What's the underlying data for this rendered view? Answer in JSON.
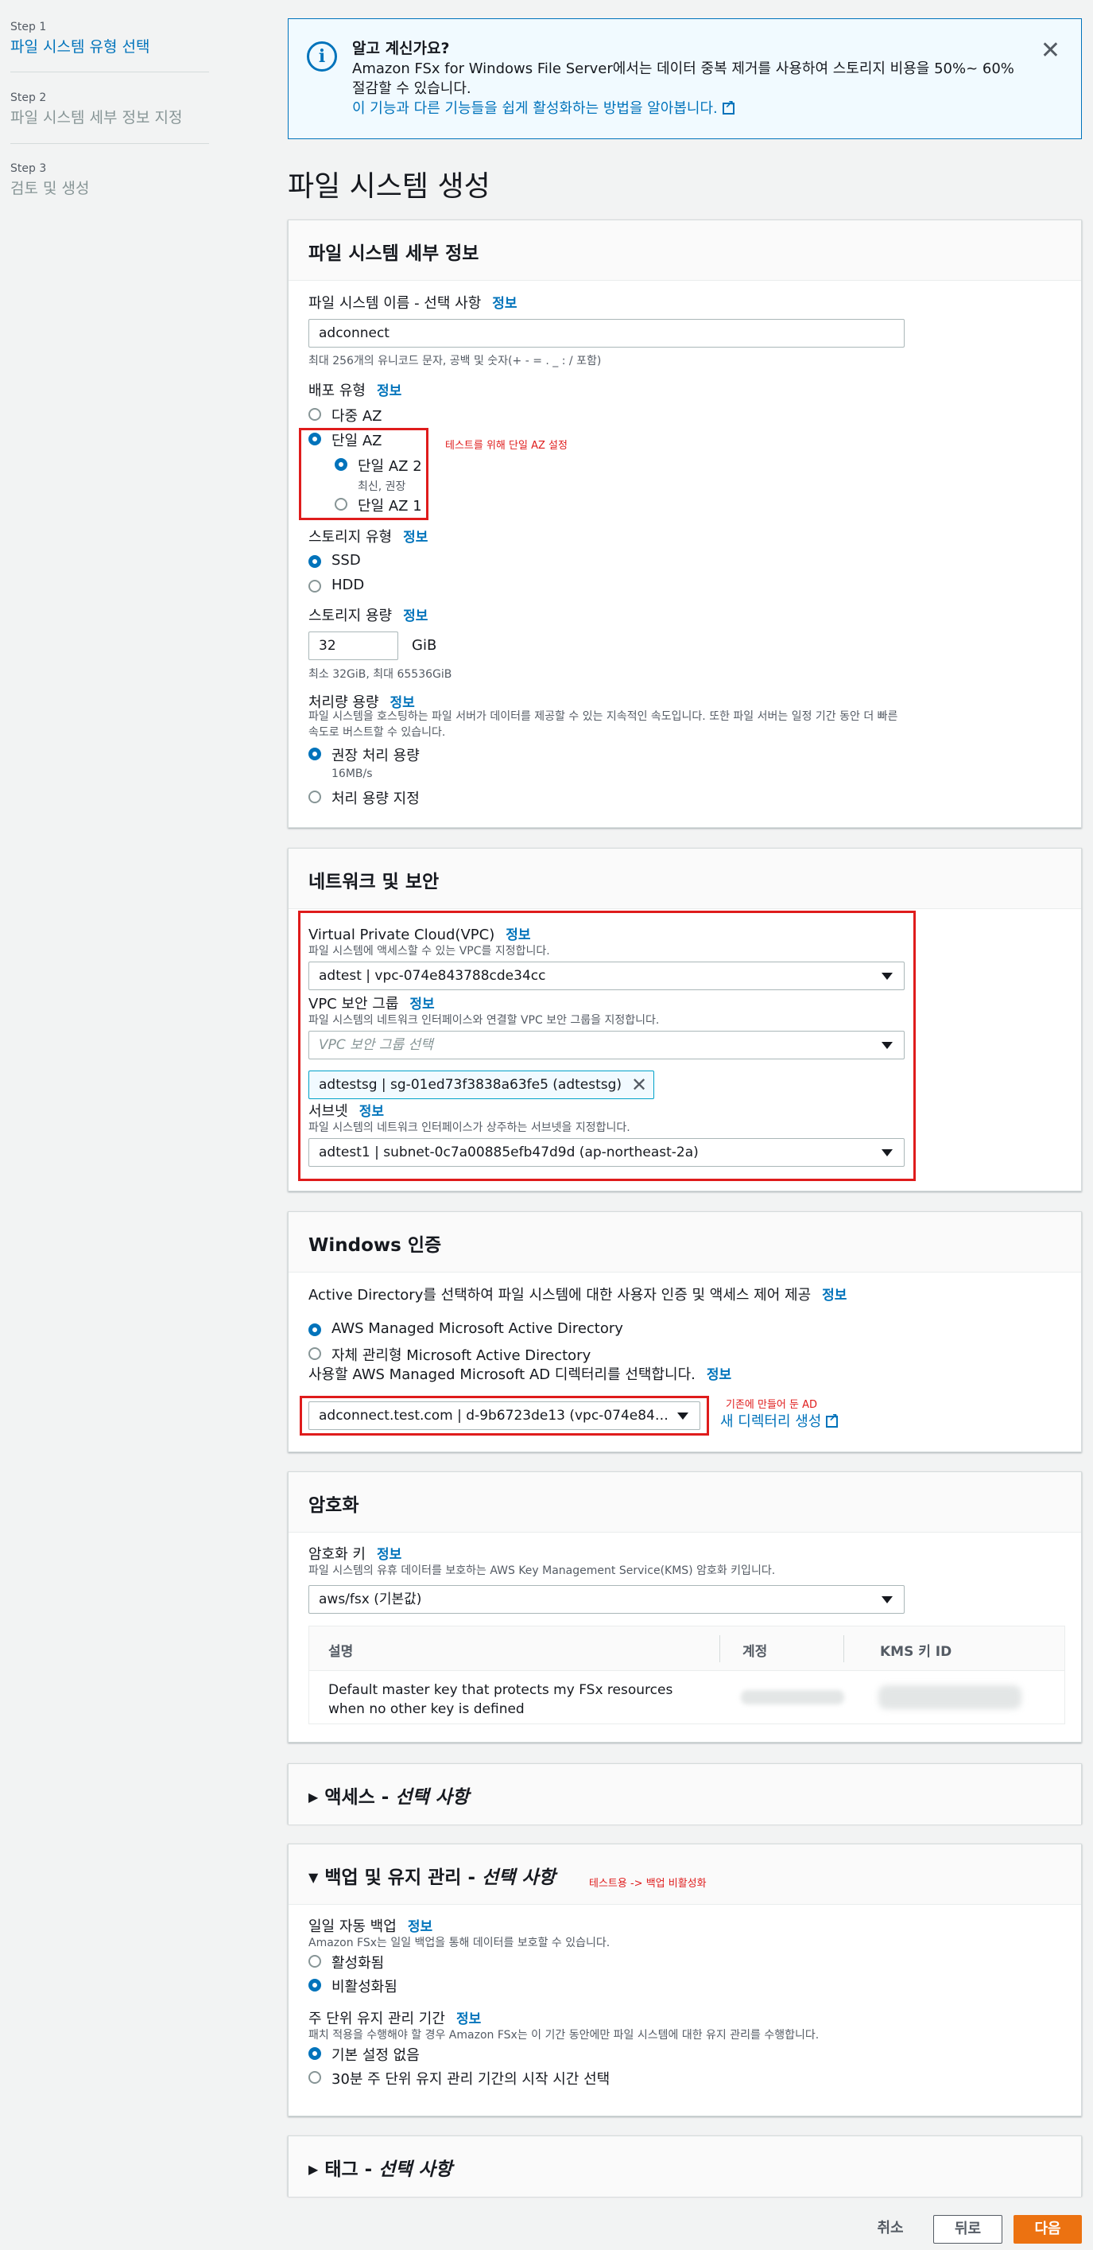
{
  "steps": [
    {
      "small": "Step 1",
      "label": "파일 시스템 유형 선택"
    },
    {
      "small": "Step 2",
      "label": "파일 시스템 세부 정보 지정"
    },
    {
      "small": "Step 3",
      "label": "검토 및 생성"
    }
  ],
  "alert": {
    "title": "알고 계신가요?",
    "body": "Amazon FSx for Windows File Server에서는 데이터 중복 제거를 사용하여 스토리지 비용을 50%~ 60% 절감할 수 있습니다.",
    "link": "이 기능과 다른 기능들을 쉽게 활성화하는 방법을 알아봅니다."
  },
  "page_title": "파일 시스템 생성",
  "info": "정보",
  "details": {
    "header": "파일 시스템 세부 정보",
    "name_label": "파일 시스템 이름 - 선택 사항",
    "name_value": "adconnect",
    "name_desc": "최대 256개의 유니코드 문자, 공백 및 숫자(+ - = . _ : / 포함)",
    "deploy_label": "배포 유형",
    "multi_az": "다중 AZ",
    "single_az": "단일 AZ",
    "single_az2": "단일 AZ 2",
    "single_az2_sub": "최신, 권장",
    "single_az1": "단일 AZ 1",
    "annotation": "테스트를 위해 단일 AZ 설정",
    "storage_type_label": "스토리지 유형",
    "ssd": "SSD",
    "hdd": "HDD",
    "capacity_label": "스토리지 용량",
    "capacity_value": "32",
    "capacity_unit": "GiB",
    "capacity_desc": "최소 32GiB, 최대 65536GiB",
    "throughput_label": "처리량 용량",
    "throughput_desc": "파일 시스템을 호스팅하는 파일 서버가 데이터를 제공할 수 있는 지속적인 속도입니다. 또한 파일 서버는 일정 기간 동안 더 빠른 속도로 버스트할 수 있습니다.",
    "recommended": "권장 처리 용량",
    "recommended_sub": "16MB/s",
    "specify": "처리 용량 지정"
  },
  "network": {
    "header": "네트워크 및 보안",
    "vpc_label": "Virtual Private Cloud(VPC)",
    "vpc_desc": "파일 시스템에 액세스할 수 있는 VPC를 지정합니다.",
    "vpc_value": "adtest | vpc-074e843788cde34cc",
    "sg_label": "VPC 보안 그룹",
    "sg_desc": "파일 시스템의 네트워크 인터페이스와 연결할 VPC 보안 그룹을 지정합니다.",
    "sg_placeholder": "VPC 보안 그룹 선택",
    "sg_token": "adtestsg | sg-01ed73f3838a63fe5 (adtestsg)",
    "subnet_label": "서브넷",
    "subnet_desc": "파일 시스템의 네트워크 인터페이스가 상주하는 서브넷을 지정합니다.",
    "subnet_value": "adtest1 | subnet-0c7a00885efb47d9d (ap-northeast-2a)"
  },
  "windows": {
    "header": "Windows 인증",
    "intro": "Active Directory를 선택하여 파일 시스템에 대한 사용자 인증 및 액세스 제어 제공",
    "managed": "AWS Managed Microsoft Active Directory",
    "self": "자체 관리형 Microsoft Active Directory",
    "dir_label": "사용할 AWS Managed Microsoft AD 디렉터리를 선택합니다.",
    "dir_value": "adconnect.test.com | d-9b6723de13 (vpc-074e843788…",
    "annotation": "기존에 만들어 둔 AD",
    "new_dir": "새 디렉터리 생성"
  },
  "encryption": {
    "header": "암호화",
    "key_label": "암호화 키",
    "key_desc": "파일 시스템의 유휴 데이터를 보호하는 AWS Key Management Service(KMS) 암호화 키입니다.",
    "key_value": "aws/fsx (기본값)",
    "columns": [
      "설명",
      "계정",
      "KMS 키 ID"
    ],
    "row_desc": "Default master key that protects my FSx resources when no other key is defined"
  },
  "access": {
    "title": "액세스 - ",
    "optional": "선택 사항"
  },
  "backup": {
    "title": "백업 및 유지 관리 - ",
    "optional": "선택 사항",
    "annotation": "테스트용 -> 백업 비활성화",
    "daily_label": "일일 자동 백업",
    "daily_desc": "Amazon FSx는 일일 백업을 통해 데이터를 보호할 수 있습니다.",
    "enabled": "활성화됨",
    "disabled": "비활성화됨",
    "weekly_label": "주 단위 유지 관리 기간",
    "weekly_desc": "패치 적용을 수행해야 할 경우 Amazon FSx는 이 기간 동안에만 파일 시스템에 대한 유지 관리를 수행합니다.",
    "no_pref": "기본 설정 없음",
    "select_start": "30분 주 단위 유지 관리 기간의 시작 시간 선택"
  },
  "tags": {
    "title": "태그 - ",
    "optional": "선택 사항"
  },
  "footer": {
    "cancel": "취소",
    "back": "뒤로",
    "next": "다음"
  }
}
